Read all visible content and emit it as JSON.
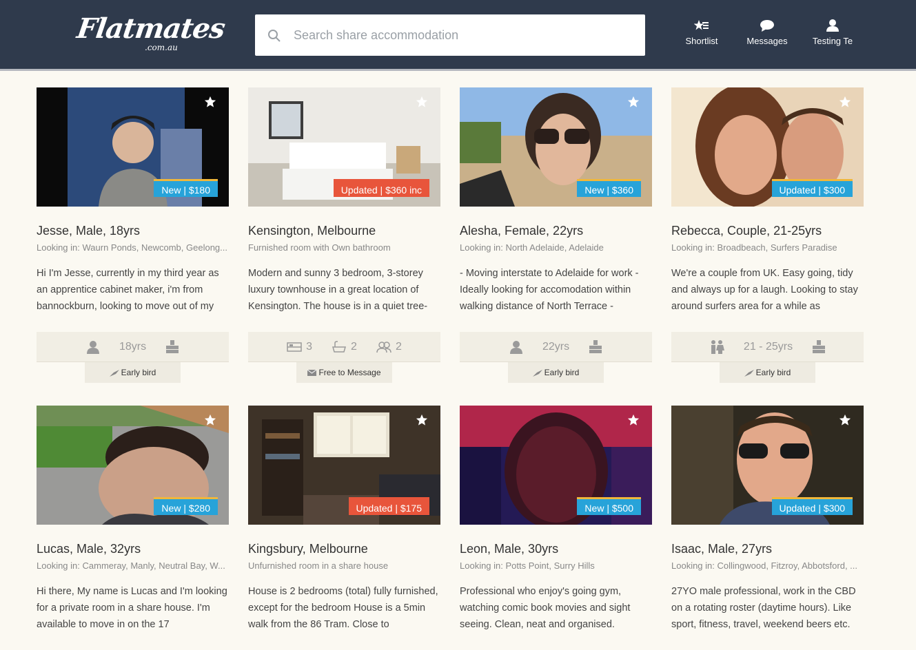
{
  "header": {
    "logo_text": "Flatmates",
    "logo_domain": ".com.au",
    "search_placeholder": "Search share accommodation",
    "nav": {
      "shortlist": "Shortlist",
      "messages": "Messages",
      "profile": "Testing Te"
    }
  },
  "colors": {
    "header_bg": "#2f3a4c",
    "badge_new": "#27a3d9",
    "badge_updated_red": "#e8553b",
    "badge_stripe": "#f0b73b",
    "page_bg": "#fbf9f2"
  },
  "cards": [
    {
      "badge": "New | $180",
      "title": "Jesse, Male, 18yrs",
      "subtitle": "Looking in: Waurn Ponds, Newcomb, Geelong...",
      "description": "Hi I'm Jesse, currently in my third year as an apprentice cabinet maker, i'm from bannockburn, looking to move out of my",
      "stat1": "18yrs",
      "tag": "Early bird"
    },
    {
      "badge": "Updated | $360 inc",
      "title": "Kensington, Melbourne",
      "subtitle": "Furnished room with Own bathroom",
      "description": "Modern and sunny 3 bedroom, 3-storey luxury townhouse in a great location of Kensington. The house is in a quiet tree-",
      "beds": "3",
      "baths": "2",
      "flatmates": "2",
      "tag": "Free to Message"
    },
    {
      "badge": "New | $360",
      "title": "Alesha, Female, 22yrs",
      "subtitle": "Looking in: North Adelaide, Adelaide",
      "description": "- Moving interstate to Adelaide for work - Ideally looking for accomodation within walking distance of North Terrace -",
      "stat1": "22yrs",
      "tag": "Early bird"
    },
    {
      "badge": "Updated | $300",
      "title": "Rebecca, Couple, 21-25yrs",
      "subtitle": "Looking in: Broadbeach, Surfers Paradise",
      "description": "We're a couple from UK. Easy going, tidy and always up for a laugh. Looking to stay around surfers area for a while as",
      "stat1": "21 - 25yrs",
      "tag": "Early bird"
    },
    {
      "badge": "New | $280",
      "title": "Lucas, Male, 32yrs",
      "subtitle": "Looking in: Cammeray, Manly, Neutral Bay, W...",
      "description": "Hi there,  My name is Lucas and I'm looking for a private room in a share house.  I'm available to move in on the 17"
    },
    {
      "badge": "Updated | $175",
      "title": "Kingsbury, Melbourne",
      "subtitle": "Unfurnished room in a share house",
      "description": "House is 2 bedrooms (total) fully furnished, except for the bedroom House is a 5min walk from the 86 Tram. Close to"
    },
    {
      "badge": "New | $500",
      "title": "Leon, Male, 30yrs",
      "subtitle": "Looking in: Potts Point, Surry Hills",
      "description": "Professional who enjoy's going gym, watching comic book movies and sight seeing. Clean, neat and organised."
    },
    {
      "badge": "Updated | $300",
      "title": "Isaac, Male, 27yrs",
      "subtitle": "Looking in: Collingwood, Fitzroy, Abbotsford, ...",
      "description": "27YO male professional, work in the CBD on a rotating roster (daytime hours). Like sport, fitness, travel, weekend beers etc."
    }
  ],
  "icons": [
    "search-icon",
    "shortlist-icon",
    "messages-icon",
    "profile-icon",
    "star-icon",
    "person-icon",
    "bed-icon",
    "bath-icon",
    "flatmates-icon",
    "couple-icon",
    "budget-icon",
    "bird-icon",
    "envelope-icon"
  ]
}
